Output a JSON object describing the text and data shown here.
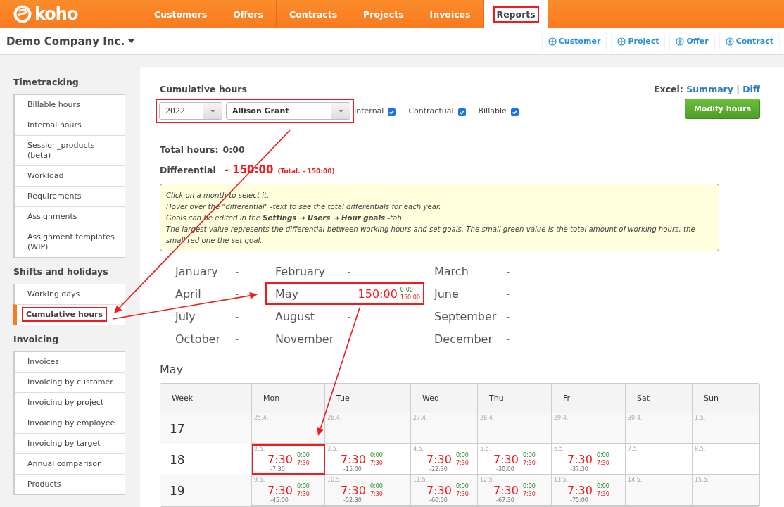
{
  "nav": {
    "logo": "koho",
    "tabs": [
      {
        "label": "Customers",
        "selected": false,
        "highlighted": false
      },
      {
        "label": "Offers",
        "selected": false,
        "highlighted": false
      },
      {
        "label": "Contracts",
        "selected": false,
        "highlighted": false
      },
      {
        "label": "Projects",
        "selected": false,
        "highlighted": false
      },
      {
        "label": "Invoices",
        "selected": false,
        "highlighted": false
      },
      {
        "label": "Reports",
        "selected": true,
        "highlighted": true
      }
    ]
  },
  "company": "Demo Company Inc.",
  "quick_add": [
    "Customer",
    "Project",
    "Offer",
    "Contract"
  ],
  "sidebar": [
    {
      "title": "Timetracking",
      "items": [
        {
          "label": "Billable hours",
          "selected": false,
          "highlighted": false
        },
        {
          "label": "Internal hours",
          "selected": false,
          "highlighted": false
        },
        {
          "label": "Session_products (beta)",
          "selected": false,
          "highlighted": false
        },
        {
          "label": "Workload",
          "selected": false,
          "highlighted": false
        },
        {
          "label": "Requirements",
          "selected": false,
          "highlighted": false
        },
        {
          "label": "Assignments",
          "selected": false,
          "highlighted": false
        },
        {
          "label": "Assignment templates (WIP)",
          "selected": false,
          "highlighted": false
        }
      ]
    },
    {
      "title": "Shifts and holidays",
      "items": [
        {
          "label": "Working days",
          "selected": false,
          "highlighted": false
        },
        {
          "label": "Cumulative hours",
          "selected": true,
          "highlighted": true
        }
      ]
    },
    {
      "title": "Invoicing",
      "items": [
        {
          "label": "Invoices",
          "selected": false,
          "highlighted": false
        },
        {
          "label": "Invoicing by customer",
          "selected": false,
          "highlighted": false
        },
        {
          "label": "Invoicing by project",
          "selected": false,
          "highlighted": false
        },
        {
          "label": "Invoicing by employee",
          "selected": false,
          "highlighted": false
        },
        {
          "label": "Invoicing by target",
          "selected": false,
          "highlighted": false
        },
        {
          "label": "Annual comparison",
          "selected": false,
          "highlighted": false
        },
        {
          "label": "Products",
          "selected": false,
          "highlighted": false
        }
      ]
    }
  ],
  "report": {
    "title": "Cumulative hours",
    "excel": {
      "label": "Excel:",
      "links": [
        "Summary",
        "Diff"
      ],
      "separator": "|"
    },
    "selects_highlighted": true,
    "year_select": {
      "value": "2022"
    },
    "user_select": {
      "value": "Allison Grant"
    },
    "filters": [
      {
        "label": "Internal",
        "checked": true
      },
      {
        "label": "Contractual",
        "checked": true
      },
      {
        "label": "Billable",
        "checked": true
      }
    ],
    "modify_button": "Modify hours",
    "total": {
      "label": "Total hours:",
      "value": "0:00"
    },
    "differential": {
      "label": "Differential",
      "value": "- 150:00",
      "total": "(Total. - 150:00)"
    },
    "info_lines": [
      "Click on a month to select it.",
      "Hover over the \"differential\" -text to see the total differentials for each year.",
      "Goals can be edited in the **Settings → Users → Hour goals** -tab.",
      "The largest value represents the differential between working hours and set goals. The small green value is the total amount of working hours, the small red one the set goal."
    ],
    "months": [
      {
        "name": "January",
        "value": "-",
        "highlighted": false
      },
      {
        "name": "February",
        "value": "-",
        "highlighted": false
      },
      {
        "name": "March",
        "value": "-",
        "highlighted": false
      },
      {
        "name": "April",
        "value": "-",
        "highlighted": false
      },
      {
        "name": "May",
        "value": "150:00",
        "worked": "0:00",
        "goal": "150:00",
        "highlighted": true
      },
      {
        "name": "June",
        "value": "-",
        "highlighted": false
      },
      {
        "name": "July",
        "value": "-",
        "highlighted": false
      },
      {
        "name": "August",
        "value": "-",
        "highlighted": false
      },
      {
        "name": "September",
        "value": "-",
        "highlighted": false
      },
      {
        "name": "October",
        "value": "-",
        "highlighted": false
      },
      {
        "name": "November",
        "value": "-",
        "highlighted": false
      },
      {
        "name": "December",
        "value": "-",
        "highlighted": false
      }
    ],
    "calendar": {
      "title": "May",
      "columns": [
        "Week",
        "Mon",
        "Tue",
        "Wed",
        "Thu",
        "Fri",
        "Sat",
        "Sun"
      ],
      "rows": [
        {
          "week": "17",
          "days": [
            {
              "date": "25.4."
            },
            {
              "date": "26.4."
            },
            {
              "date": "27.4."
            },
            {
              "date": "28.4."
            },
            {
              "date": "29.4."
            },
            {
              "date": "30.4."
            },
            {
              "date": "1.5."
            }
          ]
        },
        {
          "week": "18",
          "days": [
            {
              "date": "2.5.",
              "hours": "7:30",
              "worked": "0:00",
              "goal": "7:30",
              "cumulative": "-7:30",
              "highlighted": true
            },
            {
              "date": "3.5.",
              "hours": "7:30",
              "worked": "0:00",
              "goal": "7:30",
              "cumulative": "-15:00"
            },
            {
              "date": "4.5.",
              "hours": "7:30",
              "worked": "0:00",
              "goal": "7:30",
              "cumulative": "-22:30"
            },
            {
              "date": "5.5.",
              "hours": "7:30",
              "worked": "0:00",
              "goal": "7:30",
              "cumulative": "-30:00"
            },
            {
              "date": "6.5.",
              "hours": "7:30",
              "worked": "0:00",
              "goal": "7:30",
              "cumulative": "-37:30"
            },
            {
              "date": "7.5."
            },
            {
              "date": "8.5."
            }
          ]
        },
        {
          "week": "19",
          "days": [
            {
              "date": "9.5.",
              "hours": "7:30",
              "worked": "0:00",
              "goal": "7:30",
              "cumulative": "-45:00"
            },
            {
              "date": "10.5.",
              "hours": "7:30",
              "worked": "0:00",
              "goal": "7:30",
              "cumulative": "-52:30"
            },
            {
              "date": "11.5.",
              "hours": "7:30",
              "worked": "0:00",
              "goal": "7:30",
              "cumulative": "-60:00"
            },
            {
              "date": "12.5.",
              "hours": "7:30",
              "worked": "0:00",
              "goal": "7:30",
              "cumulative": "-67:30"
            },
            {
              "date": "13.5.",
              "hours": "7:30",
              "worked": "0:00",
              "goal": "7:30",
              "cumulative": "-75:00"
            },
            {
              "date": "14.5."
            },
            {
              "date": "15.5."
            }
          ]
        }
      ]
    }
  }
}
